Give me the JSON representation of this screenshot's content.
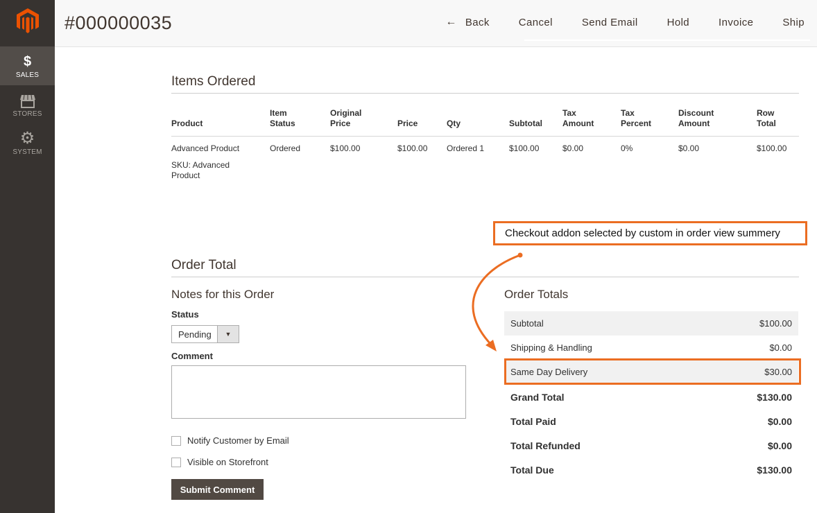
{
  "sidebar": {
    "items": [
      {
        "label": "SALES",
        "icon": "dollar-icon",
        "glyph": "$"
      },
      {
        "label": "STORES",
        "icon": "store-icon"
      },
      {
        "label": "SYSTEM",
        "icon": "gear-icon",
        "glyph": "⚙"
      }
    ]
  },
  "header": {
    "order_id": "#000000035",
    "actions": {
      "back": "Back",
      "cancel": "Cancel",
      "send_email": "Send Email",
      "hold": "Hold",
      "invoice": "Invoice",
      "ship": "Ship"
    }
  },
  "items_ordered": {
    "title": "Items Ordered",
    "columns": {
      "product": "Product",
      "item_status_1": "Item",
      "item_status_2": "Status",
      "original_price_1": "Original",
      "original_price_2": "Price",
      "price": "Price",
      "qty": "Qty",
      "subtotal": "Subtotal",
      "tax_amount_1": "Tax",
      "tax_amount_2": "Amount",
      "tax_percent_1": "Tax",
      "tax_percent_2": "Percent",
      "discount_amount_1": "Discount",
      "discount_amount_2": "Amount",
      "row_total_1": "Row",
      "row_total_2": "Total"
    },
    "row": {
      "product": "Advanced Product",
      "sku": "SKU: Advanced Product",
      "item_status": "Ordered",
      "original_price": "$100.00",
      "price": "$100.00",
      "qty": "Ordered 1",
      "subtotal": "$100.00",
      "tax_amount": "$0.00",
      "tax_percent": "0%",
      "discount_amount": "$0.00",
      "row_total": "$100.00"
    }
  },
  "order_total": {
    "title": "Order Total",
    "notes": {
      "title": "Notes for this Order",
      "status_label": "Status",
      "status_value": "Pending",
      "comment_label": "Comment",
      "comment_value": "",
      "notify_label": "Notify Customer by Email",
      "visible_label": "Visible on Storefront",
      "submit_label": "Submit Comment"
    },
    "totals": {
      "title": "Order Totals",
      "rows": [
        {
          "label": "Subtotal",
          "value": "$100.00"
        },
        {
          "label": "Shipping & Handling",
          "value": "$0.00"
        },
        {
          "label": "Same Day Delivery",
          "value": "$30.00"
        },
        {
          "label": "Grand Total",
          "value": "$130.00"
        },
        {
          "label": "Total Paid",
          "value": "$0.00"
        },
        {
          "label": "Total Refunded",
          "value": "$0.00"
        },
        {
          "label": "Total Due",
          "value": "$130.00"
        }
      ]
    }
  },
  "annotation": {
    "callout_text": "Checkout addon selected by custom in order view summery",
    "color": "#eb6d22"
  },
  "colors": {
    "sidebar": "#373330",
    "sidebar_active": "#524d49",
    "brand_orange": "#eb5202",
    "button_dark": "#514943"
  }
}
